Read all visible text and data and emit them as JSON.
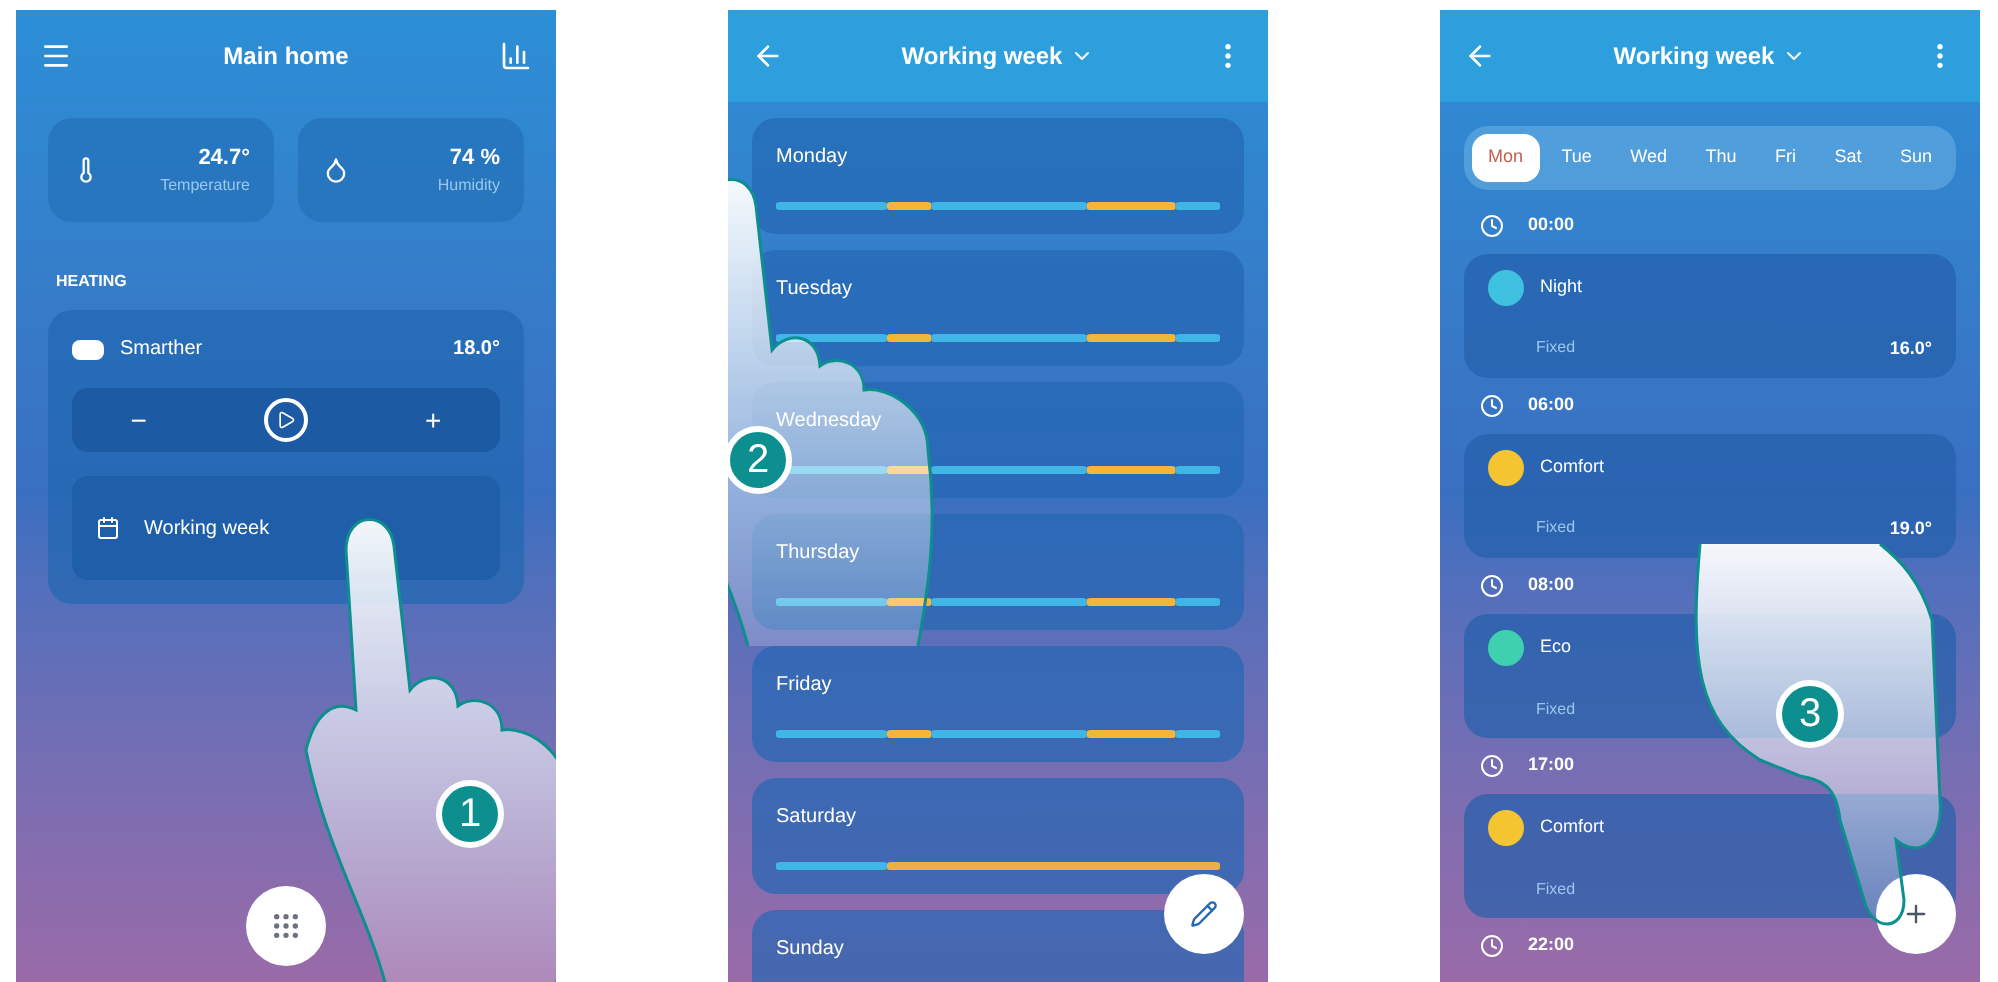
{
  "screens": [
    {
      "kind": "home",
      "step": "1",
      "header": {
        "title": "Main home"
      },
      "tiles": [
        {
          "kind": "temperature",
          "value": "24.7°",
          "caption": "Temperature"
        },
        {
          "kind": "humidity",
          "value": "74 %",
          "caption": "Humidity"
        }
      ],
      "section": "HEATING",
      "thermostat": {
        "name": "Smarther",
        "temperature": "18.0°",
        "minus": "−",
        "plus": "+",
        "program": "Working week"
      }
    },
    {
      "kind": "week",
      "step": "2",
      "header": {
        "title": "Working week"
      },
      "days": [
        {
          "name": "Monday",
          "kind": "weekday"
        },
        {
          "name": "Tuesday",
          "kind": "weekday"
        },
        {
          "name": "Wednesday",
          "kind": "weekday"
        },
        {
          "name": "Thursday",
          "kind": "weekday"
        },
        {
          "name": "Friday",
          "kind": "weekday"
        },
        {
          "name": "Saturday",
          "kind": "weekend"
        },
        {
          "name": "Sunday",
          "kind": "weekend"
        }
      ]
    },
    {
      "kind": "day",
      "step": "3",
      "header": {
        "title": "Working week"
      },
      "tabs": [
        {
          "label": "Mon",
          "selected": true
        },
        {
          "label": "Tue",
          "selected": false
        },
        {
          "label": "Wed",
          "selected": false
        },
        {
          "label": "Thu",
          "selected": false
        },
        {
          "label": "Fri",
          "selected": false
        },
        {
          "label": "Sat",
          "selected": false
        },
        {
          "label": "Sun",
          "selected": false
        }
      ],
      "entries": [
        {
          "time": "00:00",
          "mode": "Night",
          "type": "Fixed",
          "temperature": "16.0°",
          "color": "#3fc1e0"
        },
        {
          "time": "06:00",
          "mode": "Comfort",
          "type": "Fixed",
          "temperature": "19.0°",
          "color": "#f5c431"
        },
        {
          "time": "08:00",
          "mode": "Eco",
          "type": "Fixed",
          "color": "#3fd0b0"
        },
        {
          "time": "17:00",
          "mode": "Comfort",
          "type": "Fixed",
          "color": "#f5c431"
        },
        {
          "time": "22:00"
        }
      ]
    }
  ]
}
